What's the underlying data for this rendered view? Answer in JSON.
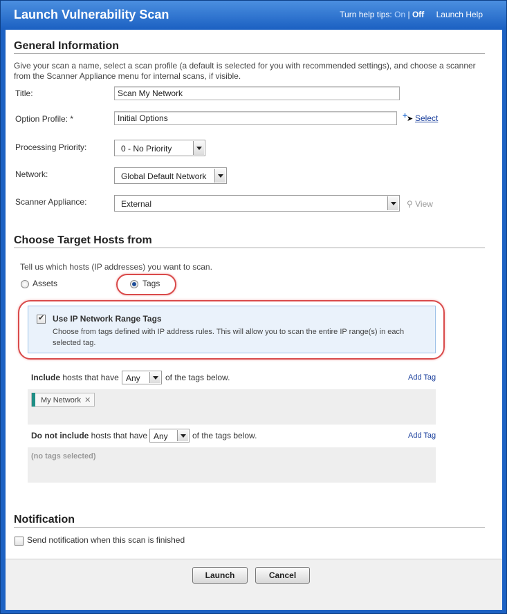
{
  "dialog": {
    "title": "Launch Vulnerability Scan",
    "help_tips_label": "Turn help tips:",
    "help_on": "On",
    "help_sep": "|",
    "help_off": "Off",
    "launch_help": "Launch Help"
  },
  "general": {
    "heading": "General Information",
    "description": "Give your scan a name, select a scan profile (a default is selected for you with recommended settings), and choose a scanner from the Scanner Appliance menu for internal scans, if visible.",
    "title_label": "Title:",
    "title_value": "Scan My Network",
    "option_profile_label": "Option Profile: *",
    "option_profile_value": "Initial Options",
    "select_link": "Select",
    "priority_label": "Processing Priority:",
    "priority_value": "0 - No Priority",
    "network_label": "Network:",
    "network_value": "Global Default Network",
    "appliance_label": "Scanner Appliance:",
    "appliance_value": "External",
    "view_link": "View"
  },
  "targets": {
    "heading": "Choose Target Hosts from",
    "description": "Tell us which hosts (IP addresses) you want to scan.",
    "assets_label": "Assets",
    "tags_label": "Tags",
    "selected": "Tags",
    "ip_range_title": "Use IP Network Range Tags",
    "ip_range_desc": "Choose from tags defined with IP address rules. This will allow you to scan the entire IP range(s) in each selected tag.",
    "ip_range_checked": true,
    "include_bold": "Include",
    "include_text": "hosts that have",
    "include_match": "Any",
    "include_suffix": "of the tags below.",
    "include_add": "Add Tag",
    "include_tags": [
      "My Network"
    ],
    "chip_remove": "✕",
    "exclude_bold": "Do not include",
    "exclude_text": "hosts that have",
    "exclude_match": "Any",
    "exclude_suffix": "of the tags below.",
    "exclude_add": "Add Tag",
    "exclude_empty": "(no tags selected)"
  },
  "notification": {
    "heading": "Notification",
    "checkbox_label": "Send notification when this scan is finished",
    "checked": false
  },
  "buttons": {
    "launch": "Launch",
    "cancel": "Cancel"
  },
  "icons": {
    "plus": "plus-icon",
    "view": "magnifier-icon",
    "pointer": "cursor-icon"
  },
  "colors": {
    "title_bar": "#1d62c3",
    "highlight": "#d94a4a",
    "tag_box": "#eaf2fb",
    "chip_accent": "#1f8f86"
  }
}
